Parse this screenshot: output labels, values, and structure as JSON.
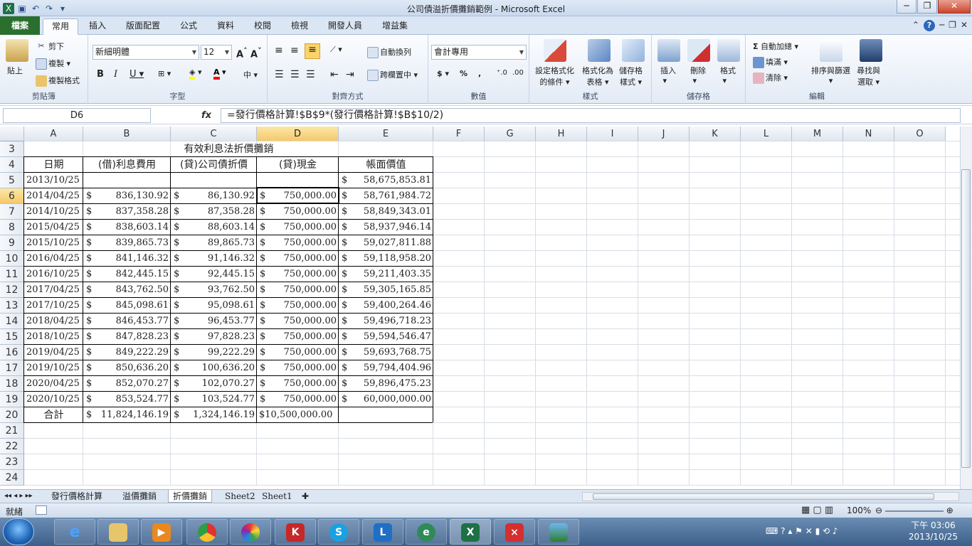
{
  "window": {
    "title": "公司債溢折價攤銷範例 - Microsoft Excel"
  },
  "ribbon_tabs": [
    "檔案",
    "常用",
    "插入",
    "版面配置",
    "公式",
    "資料",
    "校閱",
    "檢視",
    "開發人員",
    "增益集"
  ],
  "clipboard": {
    "paste": "貼上",
    "cut": "剪下",
    "copy": "複製",
    "format_painter": "複製格式",
    "label": "剪貼簿"
  },
  "font": {
    "name": "新細明體",
    "size": "12",
    "label": "字型"
  },
  "alignment": {
    "wrap": "自動換列",
    "merge": "跨欄置中",
    "label": "對齊方式"
  },
  "number": {
    "format": "會計專用",
    "label": "數值"
  },
  "styles": {
    "conditional": "設定格式化",
    "conditional2": "的條件",
    "table": "格式化為",
    "table2": "表格",
    "cell": "儲存格",
    "cell2": "樣式",
    "label": "樣式"
  },
  "cells": {
    "insert": "插入",
    "delete": "刪除",
    "format": "格式",
    "label": "儲存格"
  },
  "editing": {
    "autosum": "自動加總",
    "fill": "填滿",
    "clear": "清除",
    "sort": "排序與篩選",
    "find": "尋找與",
    "find2": "選取",
    "label": "編輯"
  },
  "formula_bar": {
    "name_box": "D6",
    "fx": "fx",
    "formula": "=發行價格計算!$B$9*(發行價格計算!$B$10/2)"
  },
  "columns": [
    "A",
    "B",
    "C",
    "D",
    "E",
    "F",
    "G",
    "H",
    "I",
    "J",
    "K",
    "L",
    "M",
    "N",
    "O"
  ],
  "active_cell": {
    "col": "D",
    "row": 6
  },
  "table": {
    "title": "有效利息法折價攤銷",
    "headers": [
      "日期",
      "(借)利息費用",
      "(貸)公司債折價",
      "(貸)現金",
      "帳面價值"
    ],
    "rows": [
      {
        "r": "5",
        "date": "2013/10/25",
        "interest": "",
        "discount": "",
        "cash": "",
        "book": "58,675,853.81"
      },
      {
        "r": "6",
        "date": "2014/04/25",
        "interest": "836,130.92",
        "discount": "86,130.92",
        "cash": "750,000.00",
        "book": "58,761,984.72"
      },
      {
        "r": "7",
        "date": "2014/10/25",
        "interest": "837,358.28",
        "discount": "87,358.28",
        "cash": "750,000.00",
        "book": "58,849,343.01"
      },
      {
        "r": "8",
        "date": "2015/04/25",
        "interest": "838,603.14",
        "discount": "88,603.14",
        "cash": "750,000.00",
        "book": "58,937,946.14"
      },
      {
        "r": "9",
        "date": "2015/10/25",
        "interest": "839,865.73",
        "discount": "89,865.73",
        "cash": "750,000.00",
        "book": "59,027,811.88"
      },
      {
        "r": "10",
        "date": "2016/04/25",
        "interest": "841,146.32",
        "discount": "91,146.32",
        "cash": "750,000.00",
        "book": "59,118,958.20"
      },
      {
        "r": "11",
        "date": "2016/10/25",
        "interest": "842,445.15",
        "discount": "92,445.15",
        "cash": "750,000.00",
        "book": "59,211,403.35"
      },
      {
        "r": "12",
        "date": "2017/04/25",
        "interest": "843,762.50",
        "discount": "93,762.50",
        "cash": "750,000.00",
        "book": "59,305,165.85"
      },
      {
        "r": "13",
        "date": "2017/10/25",
        "interest": "845,098.61",
        "discount": "95,098.61",
        "cash": "750,000.00",
        "book": "59,400,264.46"
      },
      {
        "r": "14",
        "date": "2018/04/25",
        "interest": "846,453.77",
        "discount": "96,453.77",
        "cash": "750,000.00",
        "book": "59,496,718.23"
      },
      {
        "r": "15",
        "date": "2018/10/25",
        "interest": "847,828.23",
        "discount": "97,828.23",
        "cash": "750,000.00",
        "book": "59,594,546.47"
      },
      {
        "r": "16",
        "date": "2019/04/25",
        "interest": "849,222.29",
        "discount": "99,222.29",
        "cash": "750,000.00",
        "book": "59,693,768.75"
      },
      {
        "r": "17",
        "date": "2019/10/25",
        "interest": "850,636.20",
        "discount": "100,636.20",
        "cash": "750,000.00",
        "book": "59,794,404.96"
      },
      {
        "r": "18",
        "date": "2020/04/25",
        "interest": "852,070.27",
        "discount": "102,070.27",
        "cash": "750,000.00",
        "book": "59,896,475.23"
      },
      {
        "r": "19",
        "date": "2020/10/25",
        "interest": "853,524.77",
        "discount": "103,524.77",
        "cash": "750,000.00",
        "book": "60,000,000.00"
      }
    ],
    "total": {
      "r": "20",
      "label": "合計",
      "interest": "11,824,146.19",
      "discount": "1,324,146.19",
      "cash": "$10,500,000.00"
    },
    "currency": "$"
  },
  "row_numbers": [
    "3",
    "4",
    "5",
    "6",
    "7",
    "8",
    "9",
    "10",
    "11",
    "12",
    "13",
    "14",
    "15",
    "16",
    "17",
    "18",
    "19",
    "20",
    "21",
    "22",
    "23",
    "24"
  ],
  "sheet_tabs": [
    "發行價格計算",
    "溢價攤銷",
    "折價攤銷",
    "Sheet2",
    "Sheet1"
  ],
  "active_sheet": "折價攤銷",
  "status": {
    "ready": "就緒",
    "zoom": "100%"
  },
  "clock": {
    "time": "下午 03:06",
    "date": "2013/10/25"
  }
}
